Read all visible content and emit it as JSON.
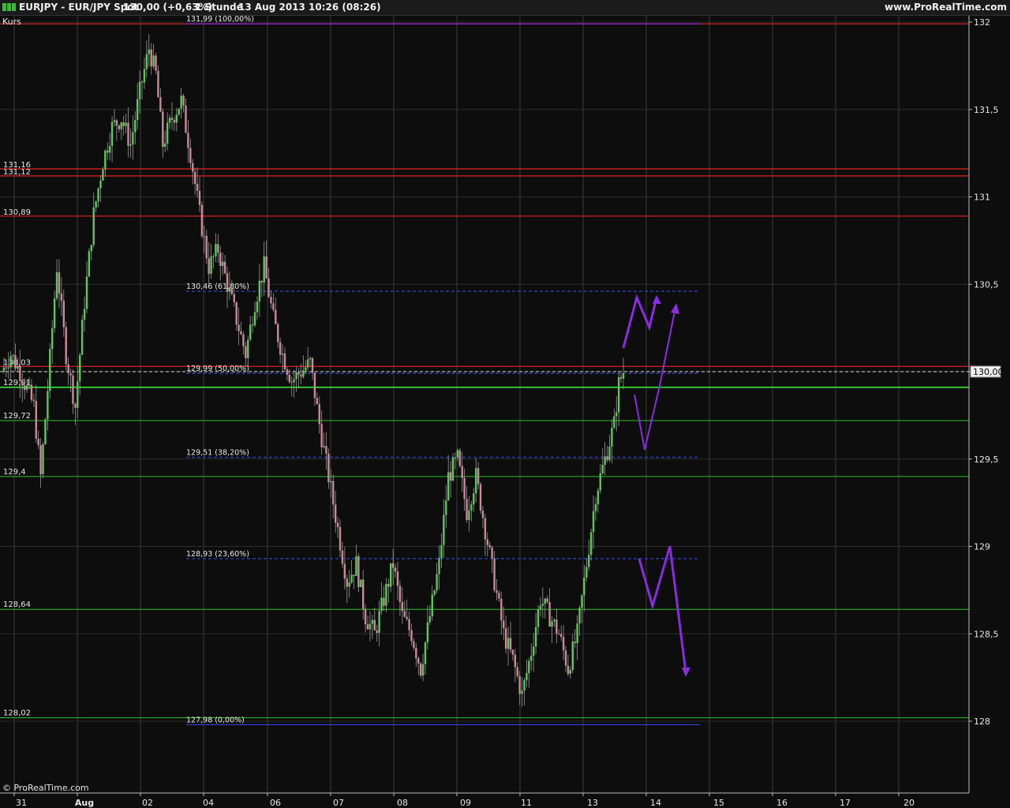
{
  "title": {
    "symbol": "EURJPY - EUR/JPY Spot",
    "quote": "130,00 (+0,63%)",
    "period": "1 Stunde",
    "datetime": "13 Aug 2013 10:26 (08:26)",
    "site": "www.ProRealTime.com"
  },
  "panel_label": "Kurs",
  "copyright": "© ProRealTime.com",
  "colors": {
    "background": "#0d0d0d",
    "up_candle": "#5cc85c",
    "down_candle": "#c98a9a",
    "resistance": "#d42020",
    "support": "#2ec42e",
    "fib": "#3344cc",
    "arrows": "#8a2be2",
    "title_icons": [
      "#27c927",
      "#27c927",
      "#27c927"
    ]
  },
  "chart_data": {
    "type": "candlestick",
    "ylim": [
      127.5,
      132.1
    ],
    "y_ticks": [
      "132",
      "131,5",
      "131",
      "130,5",
      "130",
      "129,5",
      "129",
      "128,5",
      "128"
    ],
    "y_tick_values": [
      132,
      131.5,
      131,
      130.5,
      130,
      129.5,
      129,
      128.5,
      128
    ],
    "x_ticks": [
      "31",
      "Aug",
      "02",
      "04",
      "06",
      "07",
      "08",
      "09",
      "11",
      "13",
      "14",
      "15",
      "16",
      "17",
      "20"
    ],
    "last_price": "130,00",
    "last_price_value": 130.0,
    "resistance_lines": [
      {
        "label": "131,16",
        "value": 131.16
      },
      {
        "label": "131,12",
        "value": 131.12
      },
      {
        "label": "130,89",
        "value": 130.89
      },
      {
        "label": "130,03",
        "value": 130.03
      }
    ],
    "support_lines": [
      {
        "label": "129,91",
        "value": 129.91
      },
      {
        "label": "129,72",
        "value": 129.72
      },
      {
        "label": "129,4",
        "value": 129.4
      },
      {
        "label": "128,64",
        "value": 128.64
      },
      {
        "label": "128,02",
        "value": 128.02
      }
    ],
    "fib_levels": [
      {
        "label": "131,99 (100,00%)",
        "value": 131.99
      },
      {
        "label": "130,46 (61,80%)",
        "value": 130.46
      },
      {
        "label": "129,99 (50,00%)",
        "value": 129.99
      },
      {
        "label": "129,51 (38,20%)",
        "value": 129.51
      },
      {
        "label": "128,93 (23,60%)",
        "value": 128.93
      },
      {
        "label": "127,98 (0,00%)",
        "value": 127.98
      }
    ],
    "price_path": [
      [
        0,
        130.0
      ],
      [
        4,
        130.1
      ],
      [
        8,
        130.0
      ],
      [
        14,
        129.8
      ],
      [
        17,
        129.4
      ],
      [
        20,
        129.9
      ],
      [
        24,
        130.6
      ],
      [
        28,
        130.1
      ],
      [
        32,
        129.8
      ],
      [
        36,
        130.4
      ],
      [
        40,
        130.9
      ],
      [
        44,
        131.2
      ],
      [
        48,
        131.4
      ],
      [
        52,
        131.45
      ],
      [
        56,
        131.3
      ],
      [
        60,
        131.6
      ],
      [
        64,
        131.85
      ],
      [
        67,
        131.7
      ],
      [
        70,
        131.3
      ],
      [
        74,
        131.45
      ],
      [
        78,
        131.55
      ],
      [
        82,
        131.25
      ],
      [
        86,
        130.9
      ],
      [
        90,
        130.6
      ],
      [
        94,
        130.7
      ],
      [
        98,
        130.5
      ],
      [
        102,
        130.3
      ],
      [
        106,
        130.1
      ],
      [
        110,
        130.4
      ],
      [
        114,
        130.6
      ],
      [
        118,
        130.3
      ],
      [
        122,
        130.1
      ],
      [
        126,
        129.95
      ],
      [
        130,
        130.0
      ],
      [
        134,
        130.05
      ],
      [
        138,
        129.7
      ],
      [
        142,
        129.4
      ],
      [
        146,
        129.1
      ],
      [
        150,
        128.8
      ],
      [
        154,
        128.9
      ],
      [
        158,
        128.6
      ],
      [
        162,
        128.5
      ],
      [
        166,
        128.7
      ],
      [
        170,
        128.9
      ],
      [
        174,
        128.6
      ],
      [
        178,
        128.5
      ],
      [
        182,
        128.3
      ],
      [
        186,
        128.6
      ],
      [
        190,
        128.9
      ],
      [
        194,
        129.4
      ],
      [
        198,
        129.5
      ],
      [
        202,
        129.2
      ],
      [
        206,
        129.4
      ],
      [
        210,
        129.1
      ],
      [
        214,
        128.8
      ],
      [
        218,
        128.5
      ],
      [
        222,
        128.35
      ],
      [
        226,
        128.15
      ],
      [
        230,
        128.4
      ],
      [
        234,
        128.7
      ],
      [
        238,
        128.6
      ],
      [
        242,
        128.5
      ],
      [
        246,
        128.3
      ],
      [
        250,
        128.5
      ],
      [
        254,
        128.9
      ],
      [
        258,
        129.3
      ],
      [
        262,
        129.5
      ],
      [
        266,
        129.7
      ],
      [
        268,
        129.93
      ],
      [
        270,
        130.0
      ]
    ]
  }
}
